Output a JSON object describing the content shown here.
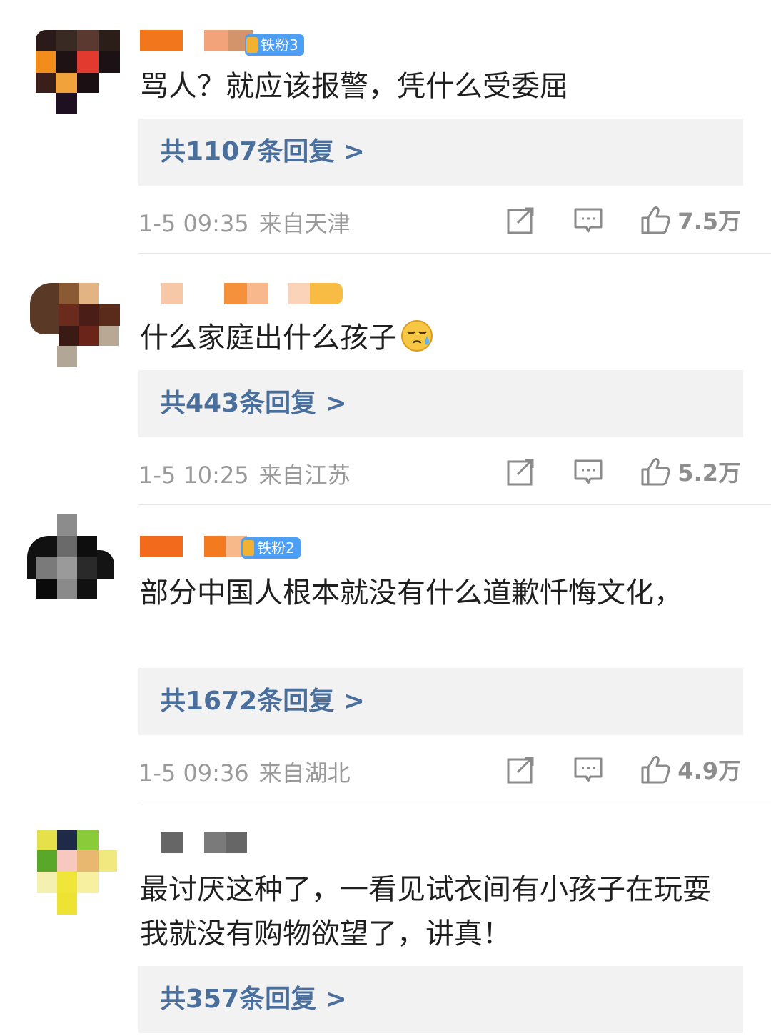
{
  "comments": [
    {
      "badge": "铁粉3",
      "text": "骂人？就应该报警，凭什么受委屈",
      "replies": "共1107条回复 >",
      "time": "1-5 09:35",
      "location": "来自天津",
      "likes": "7.5万"
    },
    {
      "text": "什么家庭出什么孩子",
      "emoji": "sweat-emoji",
      "replies": "共443条回复 >",
      "time": "1-5 10:25",
      "location": "来自江苏",
      "likes": "5.2万"
    },
    {
      "badge": "铁粉2",
      "text": "部分中国人根本就没有什么道歉忏悔文化，",
      "replies": "共1672条回复 >",
      "time": "1-5 09:36",
      "location": "来自湖北",
      "likes": "4.9万"
    },
    {
      "text": "最讨厌这种了，一看见试衣间有小孩子在玩耍我就没有购物欲望了，讲真！",
      "replies": "共357条回复 >"
    }
  ],
  "colors": {
    "reply_link": "#4a6f9d",
    "badge": "#4d9ff5",
    "meta": "#9a9a9a"
  }
}
